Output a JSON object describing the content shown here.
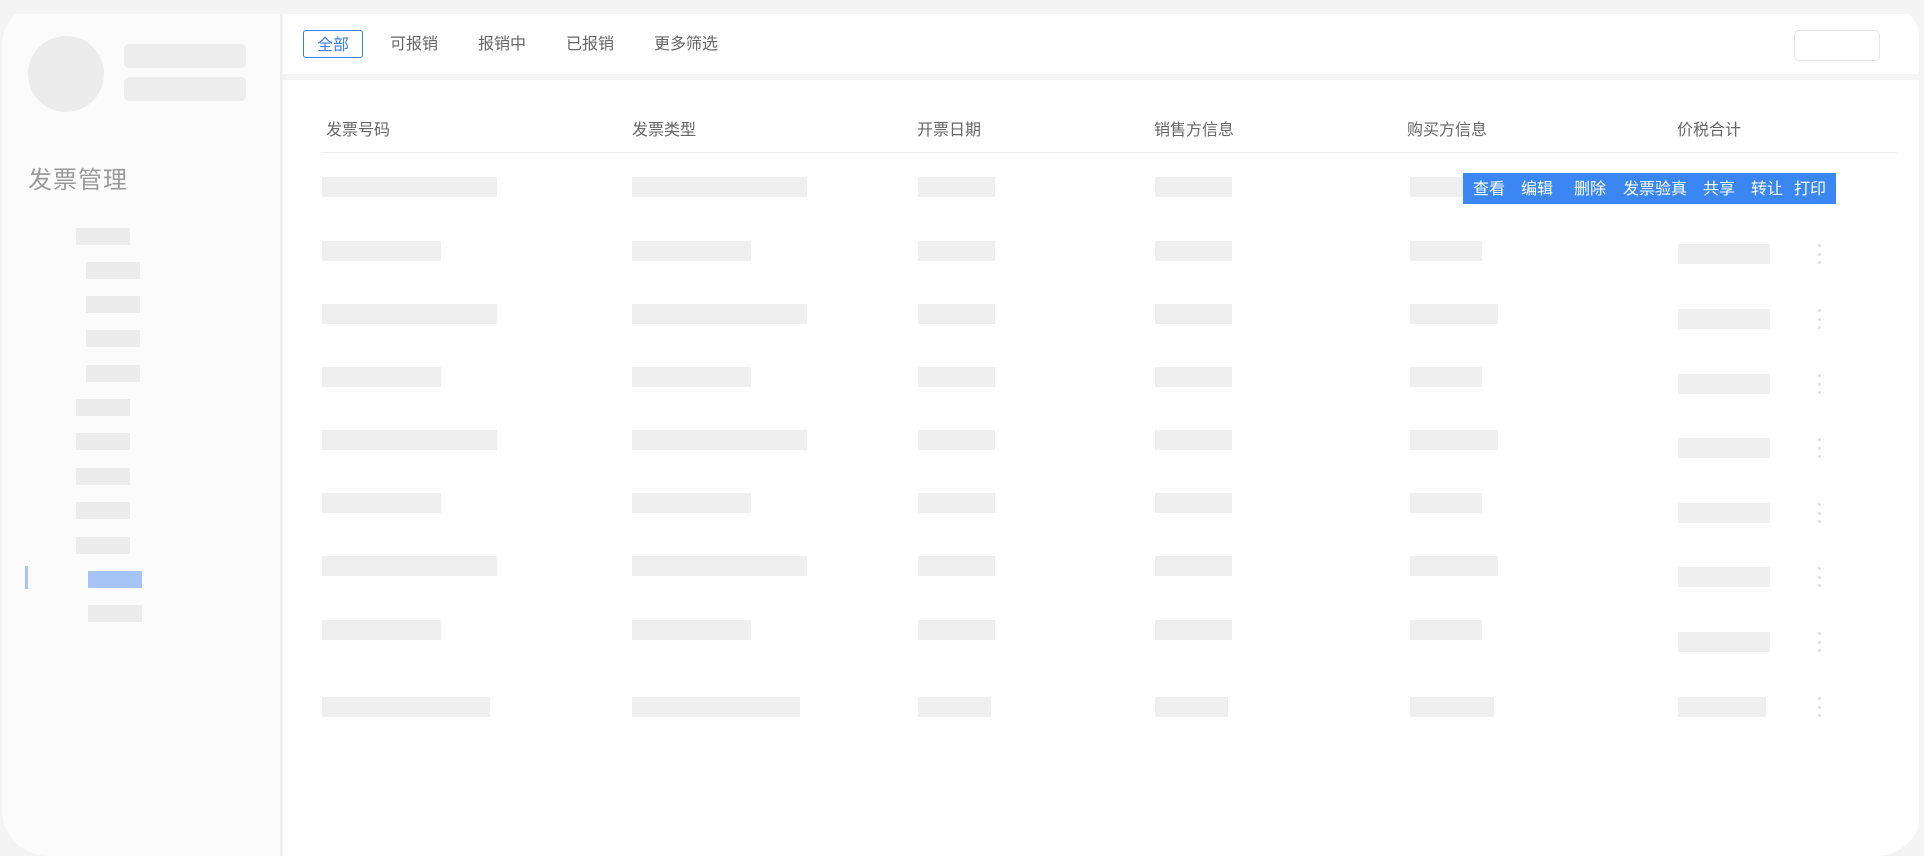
{
  "sidebar": {
    "title": "发票管理"
  },
  "tabs": [
    {
      "label": "全部",
      "active": true
    },
    {
      "label": "可报销",
      "active": false
    },
    {
      "label": "报销中",
      "active": false
    },
    {
      "label": "已报销",
      "active": false
    },
    {
      "label": "更多筛选",
      "active": false
    }
  ],
  "table": {
    "columns": [
      "发票号码",
      "发票类型",
      "开票日期",
      "销售方信息",
      "购买方信息",
      "价税合计"
    ],
    "row_count": 9
  },
  "row_actions": [
    "查看",
    "编辑",
    "删除",
    "发票验真",
    "共享",
    "转让",
    "打印"
  ],
  "colors": {
    "accent": "#3a87f3",
    "active_tab_border": "#3a7ff0",
    "skeleton": "#efefef",
    "active_nav": "#a6c4f6"
  }
}
